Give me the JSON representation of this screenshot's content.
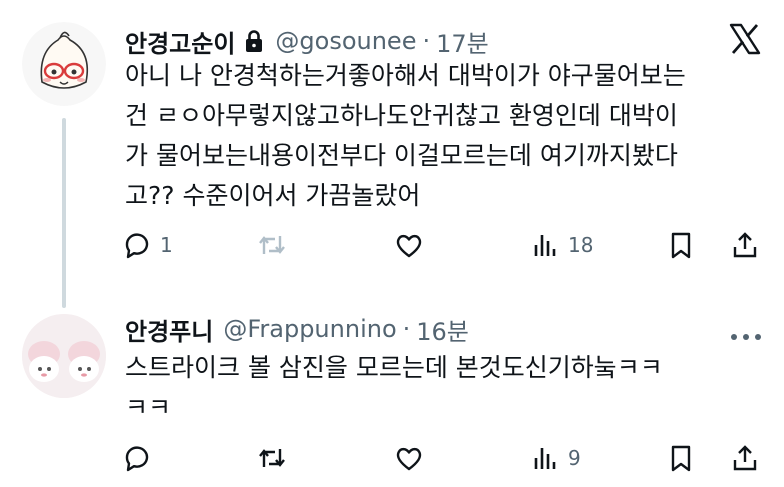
{
  "tweets": [
    {
      "author": "안경고순이",
      "handle": "@gosounee",
      "separator": "·",
      "time": "17분",
      "body": "아니 나 안경척하는거좋아해서 대박이가 야구물어보는\n건 ㄹㅇ아무렇지않고하나도안귀찮고 환영인데 대박이\n가 물어보는내용이전부다 이걸모르는데 여기까지봤다\n고?? 수준이어서 가끔놀랐어",
      "reply_count": "1",
      "retweet_count": "",
      "like_count": "",
      "view_count": "18"
    },
    {
      "author": "안경푸니",
      "handle": "@Frappunnino",
      "separator": "·",
      "time": "16분",
      "body": "스트라이크 볼 삼진을 모르는데 본것도신기하눜ㅋㅋ\nㅋㅋ",
      "reply_count": "",
      "retweet_count": "",
      "like_count": "",
      "view_count": "9"
    }
  ],
  "colors": {
    "text": "#0f1419",
    "secondary": "#536471",
    "thread_line": "#cfd9de",
    "retweet_faded": "#b0bec8"
  },
  "icons": [
    "lock-icon",
    "x-logo-icon",
    "more-icon",
    "reply-icon",
    "retweet-icon",
    "like-icon",
    "views-icon",
    "bookmark-icon",
    "share-icon"
  ]
}
